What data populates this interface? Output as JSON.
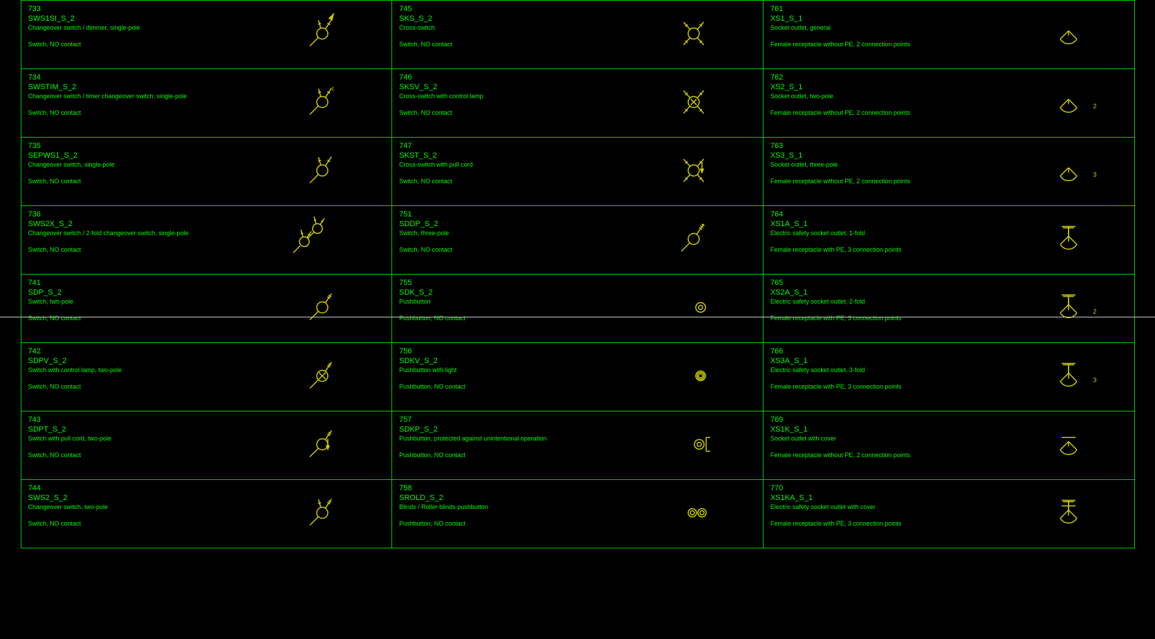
{
  "colors": {
    "stroke": "#cccc00",
    "border": "#00cc00",
    "text": "#00ff00"
  },
  "columns": 3,
  "cells": [
    {
      "num": "733",
      "code": "SWS1SI_S_2",
      "desc": "Changeover switch / dimmer, single-pole",
      "sub": "Switch, NO contact",
      "symbol": "sw_change_dim"
    },
    {
      "num": "745",
      "code": "SKS_S_2",
      "desc": "Cross-switch",
      "sub": "Switch, NO contact",
      "symbol": "cross_sw"
    },
    {
      "num": "761",
      "code": "XS1_S_1",
      "desc": "Socket outlet, general",
      "sub": "Female receptacle without PE, 2 connection points",
      "symbol": "socket"
    },
    {
      "num": "734",
      "code": "SWSTIM_S_2",
      "desc": "Changeover switch / timer changeover switch, single-pole",
      "sub": "Switch, NO contact",
      "symbol": "sw_change_t"
    },
    {
      "num": "746",
      "code": "SKSV_S_2",
      "desc": "Cross-switch with control lamp",
      "sub": "Switch, NO contact",
      "symbol": "cross_sw_lamp"
    },
    {
      "num": "762",
      "code": "XS2_S_1",
      "desc": "Socket outlet, two-pole",
      "sub": "Female receptacle without PE, 2 connection points",
      "symbol": "socket",
      "annot": "2"
    },
    {
      "num": "735",
      "code": "SEPWS1_S_2",
      "desc": "Changeover switch, single-pole",
      "sub": "Switch, NO contact",
      "symbol": "sw_change"
    },
    {
      "num": "747",
      "code": "SKST_S_2",
      "desc": "Cross-switch with pull cord",
      "sub": "Switch, NO contact",
      "symbol": "cross_sw_pull"
    },
    {
      "num": "763",
      "code": "XS3_S_1",
      "desc": "Socket outlet, three-pole",
      "sub": "Female receptacle without PE, 2 connection points",
      "symbol": "socket",
      "annot": "3"
    },
    {
      "num": "736",
      "code": "SWS2X_S_2",
      "desc": "Changeover switch / 2-fold changeover switch, single-pole",
      "sub": "Switch, NO contact",
      "symbol": "sw_change_2x"
    },
    {
      "num": "751",
      "code": "SDDP_S_2",
      "desc": "Switch, three-pole",
      "sub": "Switch, NO contact",
      "symbol": "sw_3pole"
    },
    {
      "num": "764",
      "code": "XS1A_S_1",
      "desc": "Electric safety socket outlet, 1-fold",
      "sub": "Female receptacle with PE, 3 connection points",
      "symbol": "socket_pe"
    },
    {
      "num": "741",
      "code": "SDP_S_2",
      "desc": "Switch, two-pole",
      "sub": "Switch, NO contact",
      "symbol": "sw_2pole"
    },
    {
      "num": "755",
      "code": "SDK_S_2",
      "desc": "Pushbutton",
      "sub": "Pushbutton, NO contact",
      "symbol": "pb"
    },
    {
      "num": "765",
      "code": "XS2A_S_1",
      "desc": "Electric safety socket outlet, 2-fold",
      "sub": "Female receptacle with PE, 3 connection points",
      "symbol": "socket_pe",
      "annot": "2"
    },
    {
      "num": "742",
      "code": "SDPV_S_2",
      "desc": "Switch with control lamp, two-pole",
      "sub": "Switch, NO contact",
      "symbol": "sw_2pole_lamp"
    },
    {
      "num": "756",
      "code": "SDKV_S_2",
      "desc": "Pushbutton with light",
      "sub": "Pushbutton, NO contact",
      "symbol": "pb_light"
    },
    {
      "num": "766",
      "code": "XS3A_S_1",
      "desc": "Electric safety socket outlet, 3-fold",
      "sub": "Female receptacle with PE, 3 connection points",
      "symbol": "socket_pe",
      "annot": "3"
    },
    {
      "num": "743",
      "code": "SDPT_S_2",
      "desc": "Switch with pull cord, two-pole",
      "sub": "Switch, NO contact",
      "symbol": "sw_2pole_pull"
    },
    {
      "num": "757",
      "code": "SDKP_S_2",
      "desc": "Pushbutton, protected against unintentional operation",
      "sub": "Pushbutton, NO contact",
      "symbol": "pb_prot"
    },
    {
      "num": "769",
      "code": "XS1K_S_1",
      "desc": "Socket outlet with cover",
      "sub": "Female receptacle without PE, 2 connection points",
      "symbol": "socket_cover"
    },
    {
      "num": "744",
      "code": "SWS2_S_2",
      "desc": "Changeover switch, two-pole",
      "sub": "Switch, NO contact",
      "symbol": "sw_change_2pole"
    },
    {
      "num": "758",
      "code": "SROLD_S_2",
      "desc": "Blinds / Roller blinds pushbutton",
      "sub": "Pushbutton, NO contact",
      "symbol": "pb_blinds"
    },
    {
      "num": "770",
      "code": "XS1KA_S_1",
      "desc": "Electric safety socket outlet with cover",
      "sub": "Female receptacle with PE, 3 connection points",
      "symbol": "socket_pe_cover"
    }
  ]
}
